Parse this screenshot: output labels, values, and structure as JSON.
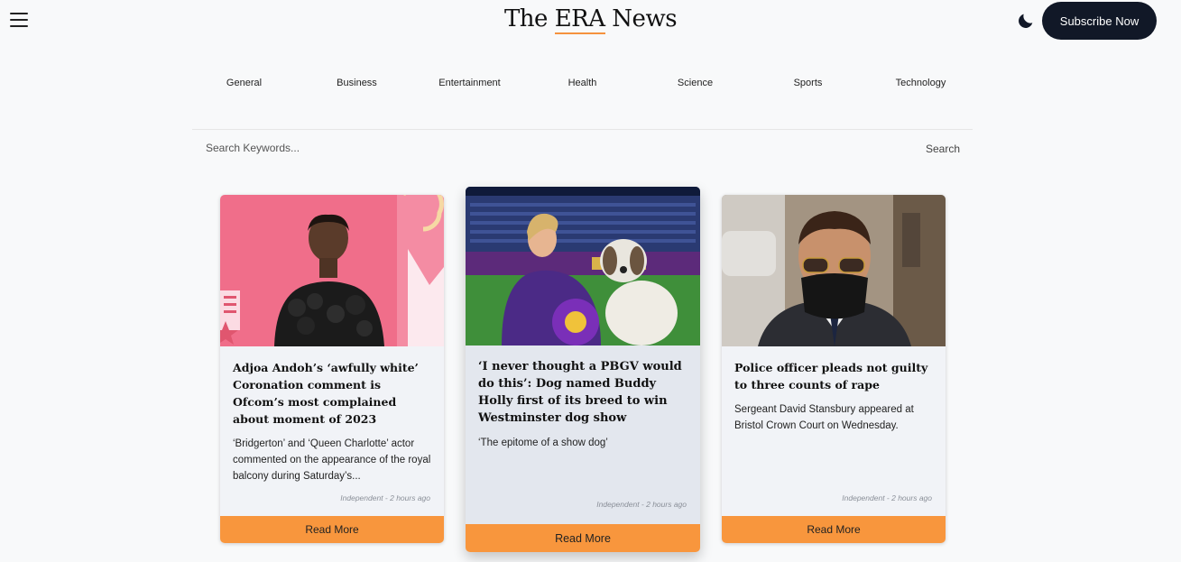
{
  "header": {
    "logo_prefix": "The ",
    "logo_accent": "ERA",
    "logo_suffix": " News",
    "subscribe_label": "Subscribe Now",
    "icons": {
      "menu": "hamburger-menu-icon",
      "theme": "moon-icon"
    }
  },
  "categories": [
    "General",
    "Business",
    "Entertainment",
    "Health",
    "Science",
    "Sports",
    "Technology"
  ],
  "search": {
    "placeholder": "Search Keywords...",
    "button_label": "Search"
  },
  "articles": [
    {
      "title": "Adjoa Andoh’s ‘awfully white’ Coronation comment is Ofcom’s most complained about moment of 2023",
      "description": "‘Bridgerton’ and ‘Queen Charlotte’ actor commented on the appearance of the royal balcony during Saturday’s...",
      "meta": "Independent - 2 hours ago",
      "read_more": "Read More"
    },
    {
      "title": "‘I never thought a PBGV would do this’: Dog named Buddy Holly first of its breed to win Westminster dog show",
      "description": "‘The epitome of a show dog’",
      "meta": "Independent - 2 hours ago",
      "read_more": "Read More"
    },
    {
      "title": "Police officer pleads not guilty to three counts of rape",
      "description": "Sergeant David Stansbury appeared at Bristol Crown Court on Wednesday.",
      "meta": "Independent - 2 hours ago",
      "read_more": "Read More"
    }
  ],
  "colors": {
    "accent": "#f8963d",
    "subscribe_bg": "#111827",
    "page_bg": "#f8f9fa"
  }
}
